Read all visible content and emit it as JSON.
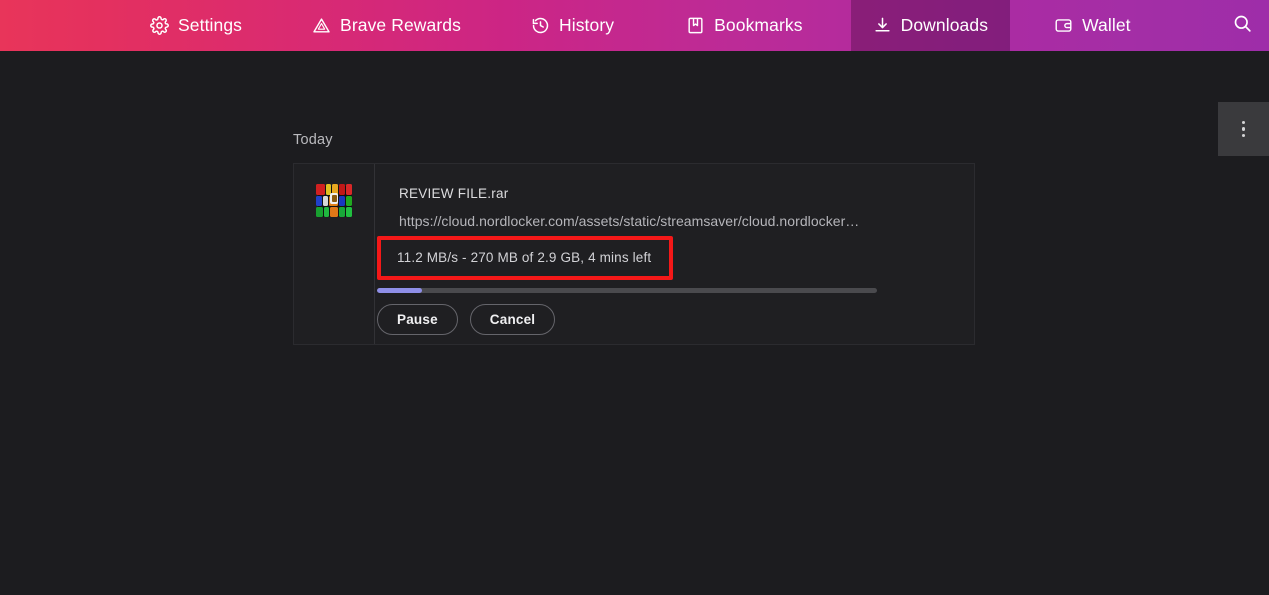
{
  "navbar": {
    "items": [
      {
        "label": "Settings",
        "icon": "gear-icon",
        "active": false
      },
      {
        "label": "Brave Rewards",
        "icon": "triangle-icon",
        "active": false
      },
      {
        "label": "History",
        "icon": "clock-icon",
        "active": false
      },
      {
        "label": "Bookmarks",
        "icon": "book-icon",
        "active": false
      },
      {
        "label": "Downloads",
        "icon": "download-icon",
        "active": true
      },
      {
        "label": "Wallet",
        "icon": "wallet-icon",
        "active": false
      }
    ],
    "search_icon": "search-icon",
    "gradient_start": "#e8355a",
    "gradient_end": "#9e2da9"
  },
  "overflow_menu": {
    "icon": "more-vertical-icon"
  },
  "downloads": {
    "section_label": "Today",
    "item": {
      "file_icon": "winrar-archive-icon",
      "filename": "REVIEW FILE.rar",
      "url": "https://cloud.nordlocker.com/assets/static/streamsaver/cloud.nordlocker…",
      "status": "11.2 MB/s - 270 MB of 2.9 GB, 4 mins left",
      "speed": "11.2 MB/s",
      "downloaded": "270 MB",
      "total_size": "2.9 GB",
      "time_left": "4 mins left",
      "progress_percent": 9,
      "progress_color": "#8f8fe8",
      "pause_label": "Pause",
      "cancel_label": "Cancel"
    }
  },
  "annotation": {
    "color": "#f41818"
  }
}
